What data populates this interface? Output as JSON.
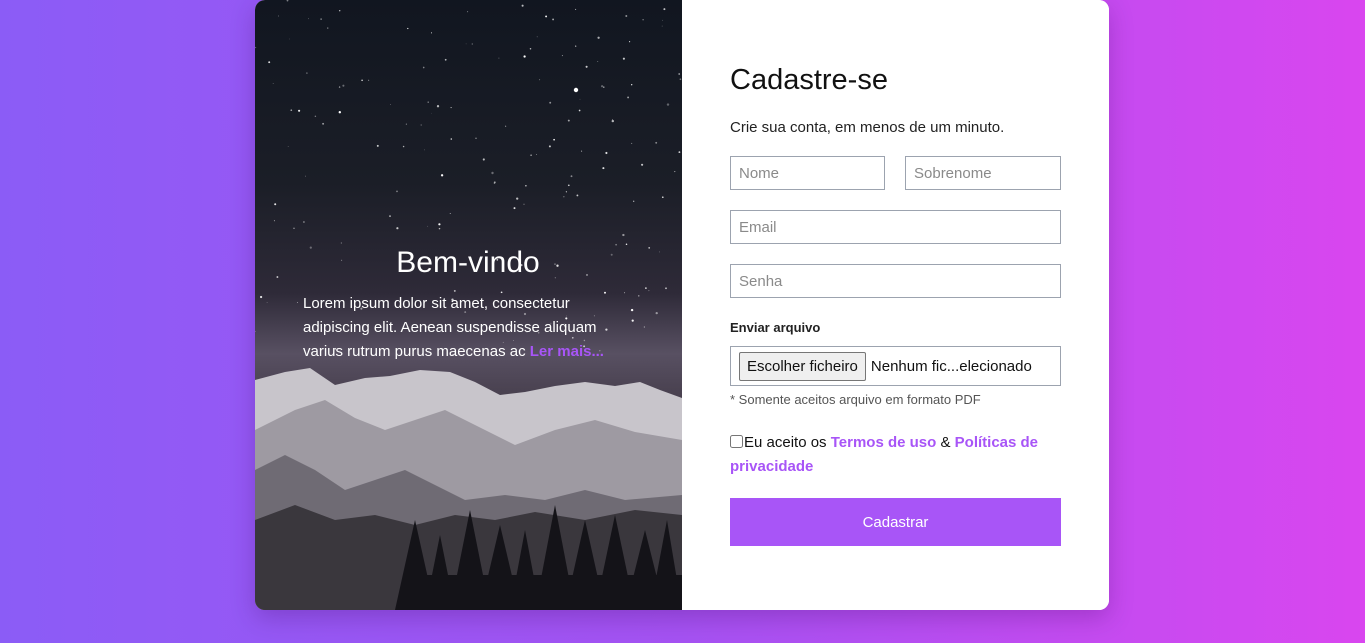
{
  "hero": {
    "title": "Bem-vindo",
    "body": "Lorem ipsum dolor sit amet, consectetur adipiscing elit. Aenean suspendisse aliquam varius rutrum purus maecenas ac ",
    "read_more": "Ler mais..."
  },
  "form": {
    "title": "Cadastre-se",
    "subtitle": "Crie sua conta, em menos de um minuto.",
    "first_name_placeholder": "Nome",
    "last_name_placeholder": "Sobrenome",
    "email_placeholder": "Email",
    "password_placeholder": "Senha",
    "file_label": "Enviar arquivo",
    "file_button": "Escolher ficheiro",
    "file_status": "Nenhum fic...elecionado",
    "file_hint": "* Somente aceitos arquivo em formato PDF",
    "terms_prefix": "Eu aceito os ",
    "terms_link": "Termos de uso",
    "terms_and": " & ",
    "privacy_link": "Políticas de privacidade",
    "submit_label": "Cadastrar"
  },
  "colors": {
    "accent": "#a855f7",
    "background_start": "#8b5cf6",
    "background_end": "#d946ef"
  }
}
